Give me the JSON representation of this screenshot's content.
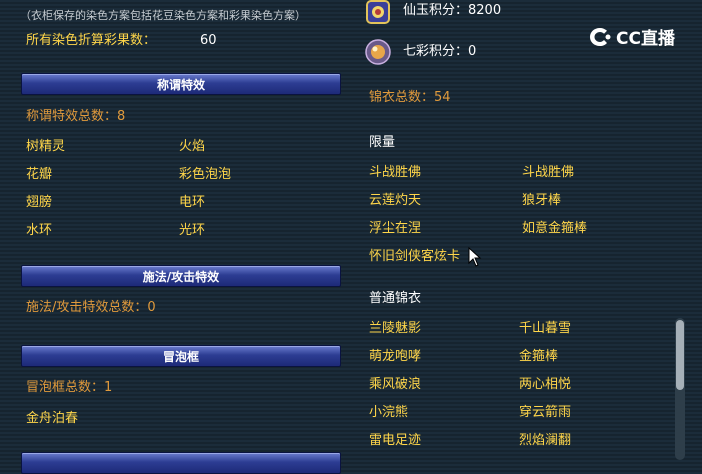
{
  "left": {
    "note": "（衣柜保存的染色方案包括花豆染色方案和彩果染色方案）",
    "total_label": "所有染色折算彩果数：",
    "total_value": "60",
    "title_section": {
      "header": "称谓特效",
      "count": "称谓特效总数：8",
      "items": [
        "树精灵",
        "火焰",
        "花瓣",
        "彩色泡泡",
        "翅膀",
        "电环",
        "水环",
        "光环"
      ]
    },
    "spell_section": {
      "header": "施法/攻击特效",
      "count": "施法/攻击特效总数：0"
    },
    "bubble_section": {
      "header": "冒泡框",
      "count": "冒泡框总数：1",
      "items": [
        "金舟泊春"
      ]
    }
  },
  "right": {
    "xianyu": {
      "label": "仙玉积分：",
      "value": "8200",
      "icon": "xianyu-icon"
    },
    "qicai": {
      "label": "七彩积分：",
      "value": "0",
      "icon": "qicai-icon"
    },
    "jinyi_total": "锦衣总数：54",
    "limited": {
      "title": "限量",
      "items": [
        "斗战胜佛",
        "斗战胜佛",
        "云莲灼天",
        "狼牙棒",
        "浮尘在涅",
        "如意金箍棒",
        "怀旧剑侠客炫卡"
      ]
    },
    "normal": {
      "title": "普通锦衣",
      "items": [
        "兰陵魅影",
        "千山暮雪",
        "萌龙咆哮",
        "金箍棒",
        "乘风破浪",
        "两心相悦",
        "小浣熊",
        "穿云箭雨",
        "雷电足迹",
        "烈焰澜翻"
      ]
    }
  },
  "watermark": {
    "text": "CC直播",
    "icon": "cc-logo-icon"
  },
  "colors": {
    "gold": "#ffd64a",
    "orange": "#e09a3c",
    "bar": "#2d3d93",
    "bg": "#1b2c3a"
  }
}
